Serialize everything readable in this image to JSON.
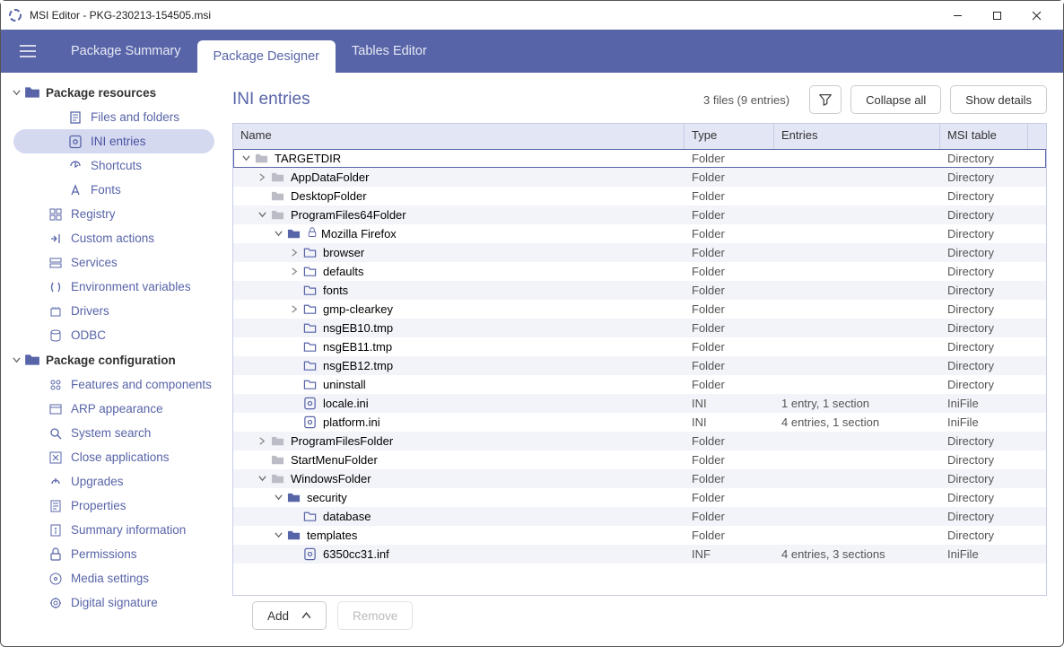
{
  "window": {
    "title": "MSI Editor - PKG-230213-154505.msi"
  },
  "tabs": {
    "summary": "Package Summary",
    "designer": "Package Designer",
    "tables": "Tables Editor"
  },
  "sidebar": {
    "resources": {
      "label": "Package resources",
      "items": {
        "files": "Files and folders",
        "ini": "INI entries",
        "shortcuts": "Shortcuts",
        "fonts": "Fonts"
      }
    },
    "registry": "Registry",
    "custom_actions": "Custom actions",
    "services": "Services",
    "env_vars": "Environment variables",
    "drivers": "Drivers",
    "odbc": "ODBC",
    "config": {
      "label": "Package configuration",
      "items": {
        "features": "Features and components",
        "arp": "ARP appearance",
        "search": "System search",
        "close_apps": "Close applications",
        "upgrades": "Upgrades",
        "properties": "Properties",
        "summary_info": "Summary information",
        "permissions": "Permissions",
        "media": "Media settings",
        "signature": "Digital signature"
      }
    }
  },
  "content": {
    "heading": "INI entries",
    "summary": "3 files (9 entries)",
    "collapse": "Collapse all",
    "show_details": "Show details",
    "columns": {
      "name": "Name",
      "type": "Type",
      "entries": "Entries",
      "msi": "MSI table"
    },
    "rows": [
      {
        "indent": 0,
        "chev": "down",
        "icon": "folder-gray",
        "name": "TARGETDIR",
        "type": "Folder",
        "entries": "",
        "msi": "Directory",
        "selected": true
      },
      {
        "indent": 1,
        "chev": "right",
        "icon": "folder-gray",
        "name": "AppDataFolder",
        "type": "Folder",
        "entries": "",
        "msi": "Directory"
      },
      {
        "indent": 1,
        "chev": "",
        "icon": "folder-gray",
        "name": "DesktopFolder",
        "type": "Folder",
        "entries": "",
        "msi": "Directory"
      },
      {
        "indent": 1,
        "chev": "down",
        "icon": "folder-gray",
        "name": "ProgramFiles64Folder",
        "type": "Folder",
        "entries": "",
        "msi": "Directory"
      },
      {
        "indent": 2,
        "chev": "down",
        "icon": "folder-blue",
        "lock": true,
        "name": "Mozilla Firefox",
        "type": "Folder",
        "entries": "",
        "msi": "Directory"
      },
      {
        "indent": 3,
        "chev": "right",
        "icon": "folder-outline",
        "name": "browser",
        "type": "Folder",
        "entries": "",
        "msi": "Directory"
      },
      {
        "indent": 3,
        "chev": "right",
        "icon": "folder-outline",
        "name": "defaults",
        "type": "Folder",
        "entries": "",
        "msi": "Directory"
      },
      {
        "indent": 3,
        "chev": "",
        "icon": "folder-outline",
        "name": "fonts",
        "type": "Folder",
        "entries": "",
        "msi": "Directory"
      },
      {
        "indent": 3,
        "chev": "right",
        "icon": "folder-outline",
        "name": "gmp-clearkey",
        "type": "Folder",
        "entries": "",
        "msi": "Directory"
      },
      {
        "indent": 3,
        "chev": "",
        "icon": "folder-outline",
        "name": "nsgEB10.tmp",
        "type": "Folder",
        "entries": "",
        "msi": "Directory"
      },
      {
        "indent": 3,
        "chev": "",
        "icon": "folder-outline",
        "name": "nsgEB11.tmp",
        "type": "Folder",
        "entries": "",
        "msi": "Directory"
      },
      {
        "indent": 3,
        "chev": "",
        "icon": "folder-outline",
        "name": "nsgEB12.tmp",
        "type": "Folder",
        "entries": "",
        "msi": "Directory"
      },
      {
        "indent": 3,
        "chev": "",
        "icon": "folder-outline",
        "name": "uninstall",
        "type": "Folder",
        "entries": "",
        "msi": "Directory"
      },
      {
        "indent": 3,
        "chev": "",
        "icon": "ini-file",
        "name": "locale.ini",
        "type": "INI",
        "entries": "1 entry, 1 section",
        "msi": "IniFile"
      },
      {
        "indent": 3,
        "chev": "",
        "icon": "ini-file",
        "name": "platform.ini",
        "type": "INI",
        "entries": "4 entries, 1 section",
        "msi": "IniFile"
      },
      {
        "indent": 1,
        "chev": "right",
        "icon": "folder-gray",
        "name": "ProgramFilesFolder",
        "type": "Folder",
        "entries": "",
        "msi": "Directory"
      },
      {
        "indent": 1,
        "chev": "",
        "icon": "folder-gray",
        "name": "StartMenuFolder",
        "type": "Folder",
        "entries": "",
        "msi": "Directory"
      },
      {
        "indent": 1,
        "chev": "down",
        "icon": "folder-gray",
        "name": "WindowsFolder",
        "type": "Folder",
        "entries": "",
        "msi": "Directory"
      },
      {
        "indent": 2,
        "chev": "down",
        "icon": "folder-blue",
        "name": "security",
        "type": "Folder",
        "entries": "",
        "msi": "Directory"
      },
      {
        "indent": 3,
        "chev": "",
        "icon": "folder-outline",
        "name": "database",
        "type": "Folder",
        "entries": "",
        "msi": "Directory"
      },
      {
        "indent": 2,
        "chev": "down",
        "icon": "folder-blue",
        "name": "templates",
        "type": "Folder",
        "entries": "",
        "msi": "Directory"
      },
      {
        "indent": 3,
        "chev": "",
        "icon": "ini-file",
        "name": "6350cc31.inf",
        "type": "INF",
        "entries": "4 entries, 3 sections",
        "msi": "IniFile"
      }
    ],
    "footer": {
      "add": "Add",
      "remove": "Remove"
    }
  }
}
